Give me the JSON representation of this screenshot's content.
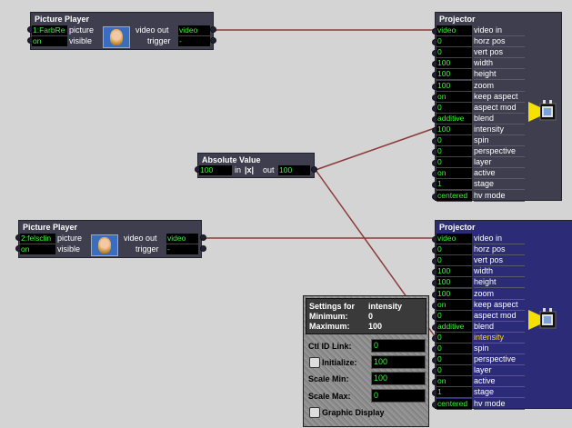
{
  "picture_player_1": {
    "title": "Picture Player",
    "inputs": [
      {
        "value": "1:FarbRe",
        "label": "picture"
      },
      {
        "value": "on",
        "label": "visible"
      }
    ],
    "outputs": [
      {
        "label": "video out",
        "value": "video"
      },
      {
        "label": "trigger",
        "value": "-"
      }
    ]
  },
  "picture_player_2": {
    "title": "Picture Player",
    "inputs": [
      {
        "value": "2:felsclin",
        "label": "picture"
      },
      {
        "value": "on",
        "label": "visible"
      }
    ],
    "outputs": [
      {
        "label": "video out",
        "value": "video"
      },
      {
        "label": "trigger",
        "value": "-"
      }
    ]
  },
  "absolute_value": {
    "title": "Absolute Value",
    "input_value": "100",
    "in_label": "in",
    "mid_label": "|x|",
    "out_label": "out",
    "output_value": "100"
  },
  "projector_1": {
    "title": "Projector",
    "rows": [
      {
        "value": "video",
        "label": "video in"
      },
      {
        "value": "0",
        "label": "horz pos"
      },
      {
        "value": "0",
        "label": "vert pos"
      },
      {
        "value": "100",
        "label": "width"
      },
      {
        "value": "100",
        "label": "height"
      },
      {
        "value": "100",
        "label": "zoom"
      },
      {
        "value": "on",
        "label": "keep aspect"
      },
      {
        "value": "0",
        "label": "aspect mod"
      },
      {
        "value": "additive",
        "label": "blend"
      },
      {
        "value": "100",
        "label": "intensity"
      },
      {
        "value": "0",
        "label": "spin"
      },
      {
        "value": "0",
        "label": "perspective"
      },
      {
        "value": "0",
        "label": "layer"
      },
      {
        "value": "on",
        "label": "active"
      },
      {
        "value": "1",
        "label": "stage"
      },
      {
        "value": "centered",
        "label": "hv mode"
      }
    ]
  },
  "projector_2": {
    "title": "Projector",
    "highlighted_row": "intensity",
    "rows": [
      {
        "value": "video",
        "label": "video in"
      },
      {
        "value": "0",
        "label": "horz pos"
      },
      {
        "value": "0",
        "label": "vert pos"
      },
      {
        "value": "100",
        "label": "width"
      },
      {
        "value": "100",
        "label": "height"
      },
      {
        "value": "100",
        "label": "zoom"
      },
      {
        "value": "on",
        "label": "keep aspect"
      },
      {
        "value": "0",
        "label": "aspect mod"
      },
      {
        "value": "additive",
        "label": "blend"
      },
      {
        "value": "0",
        "label": "intensity"
      },
      {
        "value": "0",
        "label": "spin"
      },
      {
        "value": "0",
        "label": "perspective"
      },
      {
        "value": "0",
        "label": "layer"
      },
      {
        "value": "on",
        "label": "active"
      },
      {
        "value": "1",
        "label": "stage"
      },
      {
        "value": "centered",
        "label": "hv mode"
      }
    ]
  },
  "settings_panel": {
    "settings_for_label": "Settings for",
    "settings_for_value": "intensity",
    "minimum_label": "Minimum:",
    "minimum_value": "0",
    "maximum_label": "Maximum:",
    "maximum_value": "100",
    "ctl_id_label": "Ctl ID Link:",
    "ctl_id_value": "0",
    "initialize_label": "Initialize:",
    "initialize_value": "100",
    "scale_min_label": "Scale Min:",
    "scale_min_value": "100",
    "scale_max_label": "Scale Max:",
    "scale_max_value": "0",
    "graphic_display_label": "Graphic Display"
  },
  "colors": {
    "canvas": "#d4d4d4",
    "actor_body": "#3e3e4e",
    "actor_selected": "#2b2b78",
    "value_text": "#3cf23c",
    "wire": "#8b3a3a",
    "highlight_label": "#ffd800"
  },
  "icons": [
    "picture-thumbnail-icon",
    "projector-icon",
    "checkbox-icon"
  ]
}
